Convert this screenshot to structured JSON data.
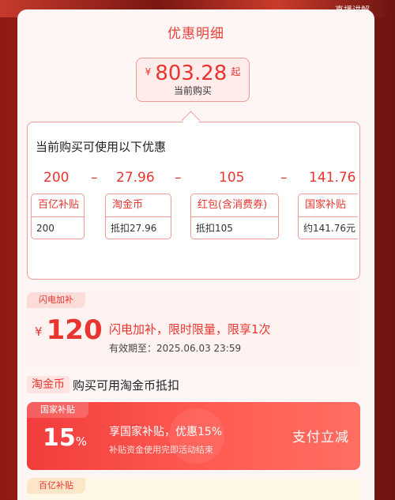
{
  "background": {
    "live_label": "直播讲解"
  },
  "sheet": {
    "title": "优惠明细"
  },
  "price": {
    "currency": "¥",
    "amount": "803.28",
    "suffix": "起",
    "label": "当前购买"
  },
  "discounts": {
    "title": "当前购买可使用以下优惠",
    "values": [
      "200",
      "27.96",
      "105",
      "141.76"
    ],
    "operators": [
      "–",
      "–",
      "–"
    ],
    "chips": [
      {
        "name": "百亿补贴",
        "detail": "200"
      },
      {
        "name": "淘金币",
        "detail": "抵扣27.96"
      },
      {
        "name": "红包(含消费券)",
        "detail": "抵扣105"
      },
      {
        "name": "国家补贴",
        "detail": "约141.76元"
      }
    ]
  },
  "flash": {
    "tag": "闪电加补",
    "currency": "¥",
    "amount": "120",
    "desc": "闪电加补，限时限量，限享1次",
    "expire": "有效期至：2025.06.03 23:59"
  },
  "taojinbi": {
    "tag": "淘金币",
    "text": "购买可用淘金币抵扣"
  },
  "gov_subsidy": {
    "tag": "国家补贴",
    "percent": "15",
    "percent_sym": "%",
    "title": "享国家补贴，优惠15%",
    "subtitle": "补贴资金使用完即活动结束",
    "action": "支付立减"
  },
  "bai_subsidy": {
    "tag": "百亿补贴"
  },
  "colors": {
    "accent": "#e8352f",
    "sheet_bg": "#fdf6f5",
    "gov_card": "#f23d3c"
  }
}
